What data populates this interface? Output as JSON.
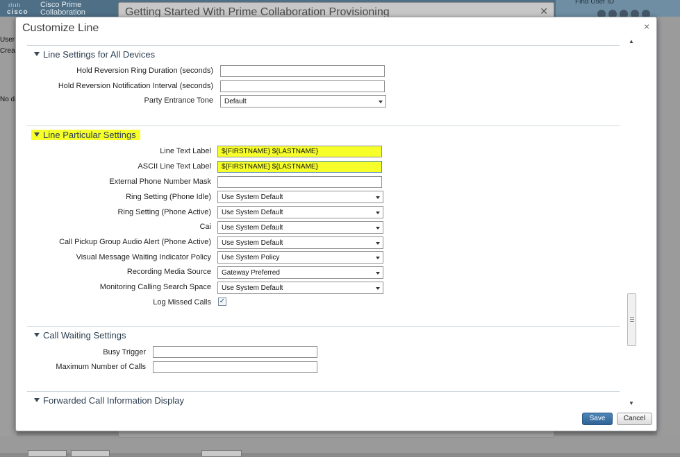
{
  "background": {
    "brand_line1": "Cisco Prime",
    "brand_line2": "Collaboration",
    "brand_logo": "cisco",
    "find_placeholder": "Find User ID",
    "other_dialog_title": "Getting Started With Prime Collaboration Provisioning",
    "side_texts": [
      "User",
      "Creat",
      "No da"
    ]
  },
  "modal": {
    "title": "Customize Line",
    "close_glyph": "×"
  },
  "sections": {
    "all_devices": {
      "title": "Line Settings for All Devices",
      "hold_ring_label": "Hold Reversion Ring Duration (seconds)",
      "hold_ring_value": "",
      "hold_notify_label": "Hold Reversion Notification Interval (seconds)",
      "hold_notify_value": "",
      "party_tone_label": "Party Entrance Tone",
      "party_tone_value": "Default"
    },
    "particular": {
      "title": "Line Particular Settings",
      "line_text_label": "Line Text Label",
      "line_text_value": "${FIRSTNAME} ${LASTNAME}",
      "ascii_label": "ASCII Line Text Label",
      "ascii_value": "${FIRSTNAME} ${LASTNAME}",
      "ext_mask_label": "External Phone Number Mask",
      "ext_mask_value": "",
      "ring_idle_label": "Ring Setting (Phone Idle)",
      "ring_idle_value": "Use System Default",
      "ring_active_label": "Ring Setting (Phone Active)",
      "ring_active_value": "Use System Default",
      "cai_label": "Cai",
      "cai_value": "Use System Default",
      "pickup_label": "Call Pickup Group Audio Alert (Phone Active)",
      "pickup_value": "Use System Default",
      "vmwi_label": "Visual Message Waiting Indicator Policy",
      "vmwi_value": "Use System Policy",
      "rec_label": "Recording Media Source",
      "rec_value": "Gateway Preferred",
      "mon_label": "Monitoring Calling Search Space",
      "mon_value": "Use System Default",
      "log_label": "Log Missed Calls",
      "log_checked": true
    },
    "call_waiting": {
      "title": "Call Waiting Settings",
      "busy_label": "Busy Trigger",
      "busy_value": "",
      "max_label": "Maximum Number of Calls",
      "max_value": ""
    },
    "forwarded": {
      "title": "Forwarded Call Information Display"
    }
  },
  "footer": {
    "save_label": "Save",
    "cancel_label": "Cancel"
  },
  "colors": {
    "highlight": "#f7ff2a",
    "primary_button": "#2f6395",
    "topbar": "#4f6f86"
  },
  "icons": {
    "expand": "triangle-down-icon",
    "checkbox": "checkmark-icon"
  }
}
